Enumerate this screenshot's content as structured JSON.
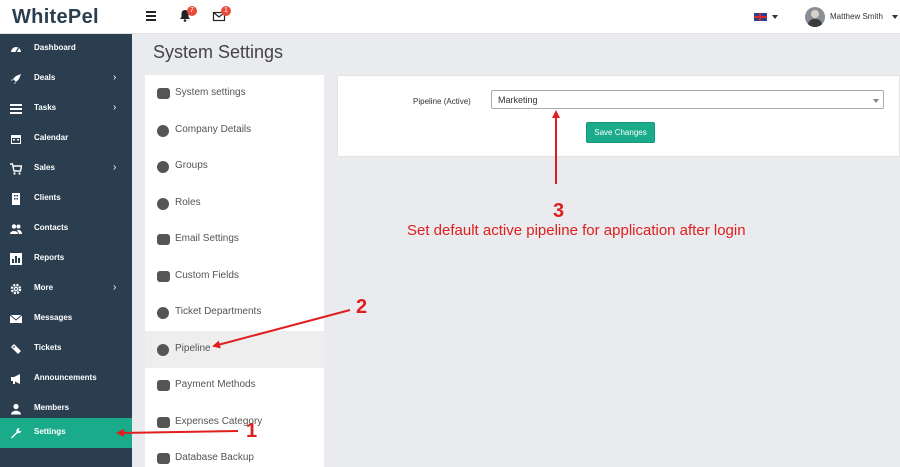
{
  "app": {
    "logo": "WhitePel"
  },
  "header": {
    "notifications_count": "7",
    "messages_count": "1",
    "user_name": "Matthew Smith"
  },
  "sidebar": {
    "items": [
      {
        "label": "Dashboard",
        "icon": "dashboard-icon",
        "has_submenu": false
      },
      {
        "label": "Deals",
        "icon": "rocket-icon",
        "has_submenu": true
      },
      {
        "label": "Tasks",
        "icon": "tasks-icon",
        "has_submenu": true
      },
      {
        "label": "Calendar",
        "icon": "calendar-icon",
        "has_submenu": false
      },
      {
        "label": "Sales",
        "icon": "cart-icon",
        "has_submenu": true
      },
      {
        "label": "Clients",
        "icon": "building-icon",
        "has_submenu": false
      },
      {
        "label": "Contacts",
        "icon": "users-icon",
        "has_submenu": false
      },
      {
        "label": "Reports",
        "icon": "chart-icon",
        "has_submenu": false
      },
      {
        "label": "More",
        "icon": "gear-icon",
        "has_submenu": true
      },
      {
        "label": "Messages",
        "icon": "envelope-icon",
        "has_submenu": false
      },
      {
        "label": "Tickets",
        "icon": "ticket-icon",
        "has_submenu": false
      },
      {
        "label": "Announcements",
        "icon": "bullhorn-icon",
        "has_submenu": false
      },
      {
        "label": "Members",
        "icon": "user-icon",
        "has_submenu": false
      },
      {
        "label": "Settings",
        "icon": "wrench-icon",
        "has_submenu": false,
        "active": true
      }
    ]
  },
  "page": {
    "title": "System Settings"
  },
  "settings_menu": {
    "items": [
      {
        "label": "System settings",
        "icon": "monitor-icon"
      },
      {
        "label": "Company Details",
        "icon": "bolt-icon"
      },
      {
        "label": "Groups",
        "icon": "comment-icon"
      },
      {
        "label": "Roles",
        "icon": "plus-circle-icon"
      },
      {
        "label": "Email Settings",
        "icon": "envelope-icon"
      },
      {
        "label": "Custom Fields",
        "icon": "shuffle-icon"
      },
      {
        "label": "Ticket Departments",
        "icon": "tag-icon"
      },
      {
        "label": "Pipeline",
        "icon": "filter-icon",
        "active": true
      },
      {
        "label": "Payment Methods",
        "icon": "credit-card-icon"
      },
      {
        "label": "Expenses Category",
        "icon": "money-icon"
      },
      {
        "label": "Database Backup",
        "icon": "database-icon"
      }
    ]
  },
  "form": {
    "pipeline_label": "Pipeline (Active)",
    "pipeline_value": "Marketing",
    "save_label": "Save Changes"
  },
  "annotations": {
    "note": "Set default active pipeline for application after login",
    "num1": "1",
    "num2": "2",
    "num3": "3",
    "color": "#e01e1e"
  },
  "colors": {
    "sidebar_bg": "#2b3e50",
    "accent": "#1aab8a",
    "badge": "#e74c3c"
  }
}
